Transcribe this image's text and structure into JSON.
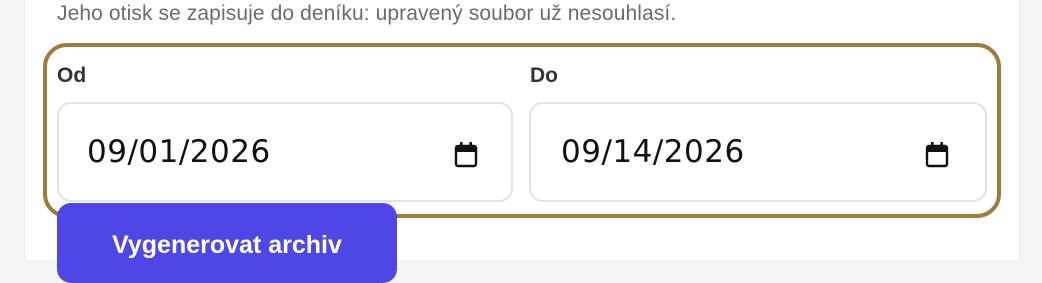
{
  "form": {
    "help_text": "Jeho otisk se zapisuje do deníku: upravený soubor už nesouhlasí.",
    "from": {
      "label": "Od",
      "value": "09/01/2026",
      "icon": "calendar-icon"
    },
    "to": {
      "label": "Do",
      "value": "09/14/2026",
      "icon": "calendar-icon"
    },
    "submit_label": "Vygenerovat archiv"
  },
  "colors": {
    "highlight_border": "#a07c3c",
    "primary_button": "#4f46e5"
  }
}
